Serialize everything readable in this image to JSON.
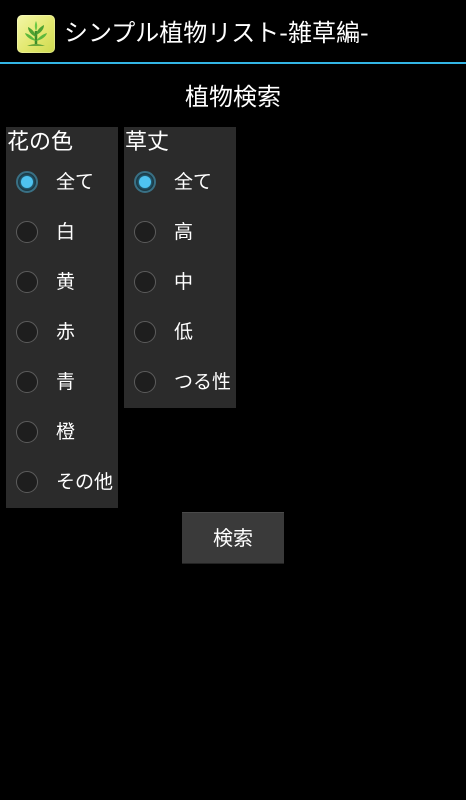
{
  "action_bar": {
    "title": "シンプル植物リスト-雑草編-",
    "icon": "app-plant-icon",
    "accent_color": "#33b5e5"
  },
  "page": {
    "heading": "植物検索"
  },
  "flower_color_group": {
    "title": "花の色",
    "options": [
      {
        "label": "全て",
        "checked": true
      },
      {
        "label": "白",
        "checked": false
      },
      {
        "label": "黄",
        "checked": false
      },
      {
        "label": "赤",
        "checked": false
      },
      {
        "label": "青",
        "checked": false
      },
      {
        "label": "橙",
        "checked": false
      },
      {
        "label": "その他",
        "checked": false
      }
    ]
  },
  "plant_height_group": {
    "title": "草丈",
    "options": [
      {
        "label": "全て",
        "checked": true
      },
      {
        "label": "高",
        "checked": false
      },
      {
        "label": "中",
        "checked": false
      },
      {
        "label": "低",
        "checked": false
      },
      {
        "label": "つる性",
        "checked": false
      }
    ]
  },
  "search_button": {
    "label": "検索"
  }
}
